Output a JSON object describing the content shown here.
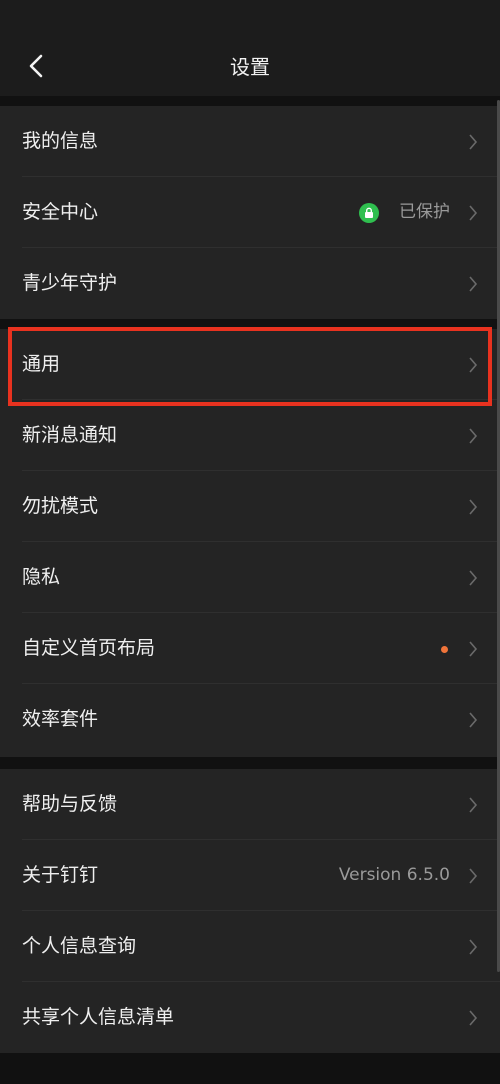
{
  "header": {
    "title": "设置"
  },
  "group1": {
    "items": [
      {
        "label": "我的信息"
      },
      {
        "label": "安全中心",
        "value": "已保护"
      },
      {
        "label": "青少年守护"
      },
      {
        "label": "通用"
      },
      {
        "label": "新消息通知"
      },
      {
        "label": "勿扰模式"
      },
      {
        "label": "隐私"
      },
      {
        "label": "自定义首页布局"
      },
      {
        "label": "效率套件"
      }
    ]
  },
  "group2": {
    "items": [
      {
        "label": "帮助与反馈"
      },
      {
        "label": "关于钉钉",
        "value": "Version 6.5.0"
      },
      {
        "label": "个人信息查询"
      },
      {
        "label": "共享个人信息清单"
      }
    ]
  },
  "colors": {
    "highlight": "#e8321f",
    "protected": "#2fbf4f",
    "badge_dot": "#f0743a"
  },
  "icons": {
    "back": "back-arrow-icon",
    "chevron": "chevron-right-icon",
    "shield": "lock-shield-icon"
  }
}
